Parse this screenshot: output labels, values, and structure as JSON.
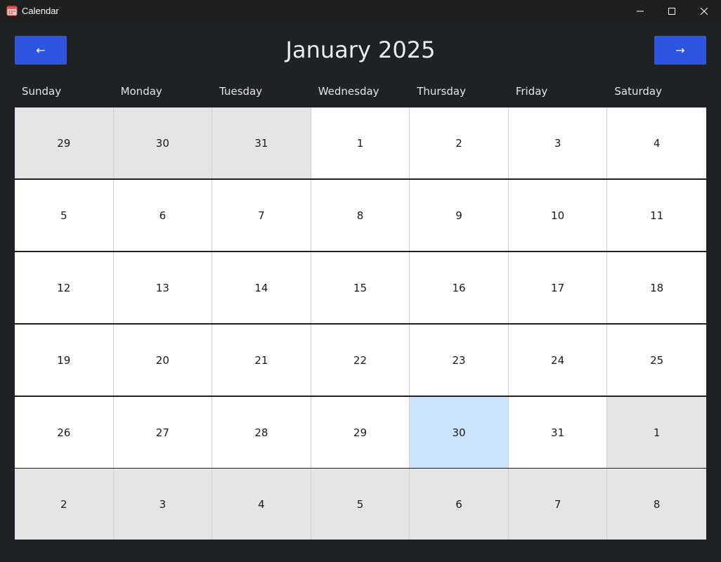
{
  "window": {
    "title": "Calendar",
    "app_icon": "calendar-icon",
    "controls": [
      "minimize-icon",
      "maximize-icon",
      "close-icon"
    ]
  },
  "header": {
    "prev_label": "←",
    "next_label": "→",
    "month_title": "January 2025"
  },
  "weekdays": [
    "Sunday",
    "Monday",
    "Tuesday",
    "Wednesday",
    "Thursday",
    "Friday",
    "Saturday"
  ],
  "weeks": [
    [
      {
        "day": "29",
        "state": "other"
      },
      {
        "day": "30",
        "state": "other"
      },
      {
        "day": "31",
        "state": "other"
      },
      {
        "day": "1",
        "state": "current"
      },
      {
        "day": "2",
        "state": "current"
      },
      {
        "day": "3",
        "state": "current"
      },
      {
        "day": "4",
        "state": "current"
      }
    ],
    [
      {
        "day": "5",
        "state": "current"
      },
      {
        "day": "6",
        "state": "current"
      },
      {
        "day": "7",
        "state": "current"
      },
      {
        "day": "8",
        "state": "current"
      },
      {
        "day": "9",
        "state": "current"
      },
      {
        "day": "10",
        "state": "current"
      },
      {
        "day": "11",
        "state": "current"
      }
    ],
    [
      {
        "day": "12",
        "state": "current"
      },
      {
        "day": "13",
        "state": "current"
      },
      {
        "day": "14",
        "state": "current"
      },
      {
        "day": "15",
        "state": "current"
      },
      {
        "day": "16",
        "state": "current"
      },
      {
        "day": "17",
        "state": "current"
      },
      {
        "day": "18",
        "state": "current"
      }
    ],
    [
      {
        "day": "19",
        "state": "current"
      },
      {
        "day": "20",
        "state": "current"
      },
      {
        "day": "21",
        "state": "current"
      },
      {
        "day": "22",
        "state": "current"
      },
      {
        "day": "23",
        "state": "current"
      },
      {
        "day": "24",
        "state": "current"
      },
      {
        "day": "25",
        "state": "current"
      }
    ],
    [
      {
        "day": "26",
        "state": "current"
      },
      {
        "day": "27",
        "state": "current"
      },
      {
        "day": "28",
        "state": "current"
      },
      {
        "day": "29",
        "state": "current"
      },
      {
        "day": "30",
        "state": "today"
      },
      {
        "day": "31",
        "state": "current"
      },
      {
        "day": "1",
        "state": "other"
      }
    ],
    [
      {
        "day": "2",
        "state": "other"
      },
      {
        "day": "3",
        "state": "other"
      },
      {
        "day": "4",
        "state": "other"
      },
      {
        "day": "5",
        "state": "other"
      },
      {
        "day": "6",
        "state": "other"
      },
      {
        "day": "7",
        "state": "other"
      },
      {
        "day": "8",
        "state": "other"
      }
    ]
  ],
  "colors": {
    "background": "#202124",
    "nav_button": "#2f55e0",
    "cell_current": "#ffffff",
    "cell_other": "#e5e5e5",
    "cell_today": "#cce4ff"
  }
}
